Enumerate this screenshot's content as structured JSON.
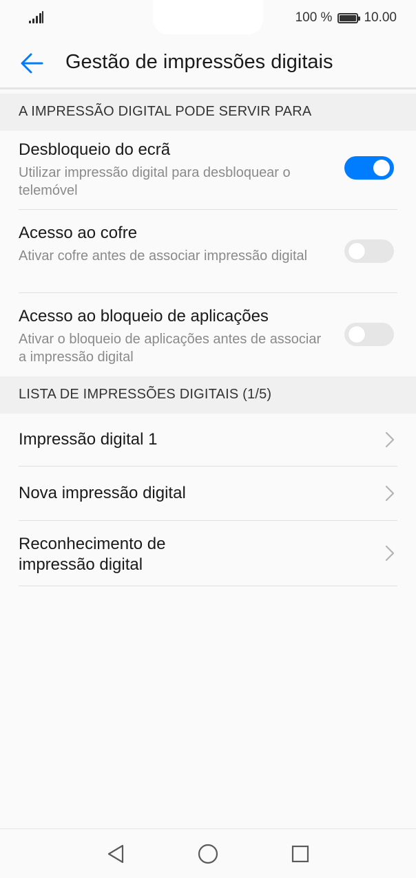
{
  "status_bar": {
    "battery_text": "100 %",
    "time": "10.00",
    "battery_level": 1.0,
    "signal_icon": "signal-icon",
    "battery_icon": "battery-icon"
  },
  "app_bar": {
    "back_icon": "arrow-left-icon",
    "title": "Gestão de impressões digitais"
  },
  "sections": {
    "usage": {
      "header": "A IMPRESSÃO DIGITAL PODE SERVIR PARA",
      "items": [
        {
          "title": "Desbloqueio do ecrã",
          "subtitle": "Utilizar impressão digital para desbloquear o telemóvel",
          "enabled": true
        },
        {
          "title": "Acesso ao cofre",
          "subtitle": "Ativar cofre antes de associar impressão digital",
          "enabled": false
        },
        {
          "title": "Acesso ao bloqueio de aplicações",
          "subtitle": "Ativar o bloqueio de aplicações antes de associar a impressão digital",
          "enabled": false
        }
      ]
    },
    "list": {
      "header": "LISTA DE IMPRESSÕES DIGITAIS (1/5)",
      "items": [
        {
          "label": "Impressão digital 1"
        },
        {
          "label": "Nova impressão digital"
        },
        {
          "label": "Reconhecimento de impressão digital"
        }
      ]
    }
  },
  "nav_bar": {
    "back_icon": "triangle-back-icon",
    "home_icon": "circle-home-icon",
    "recents_icon": "square-recents-icon"
  },
  "colors": {
    "accent": "#007dff",
    "toggle_off": "#e6e6e6",
    "section_bg": "#f0f0f0",
    "subtitle": "#8a8a8a"
  }
}
